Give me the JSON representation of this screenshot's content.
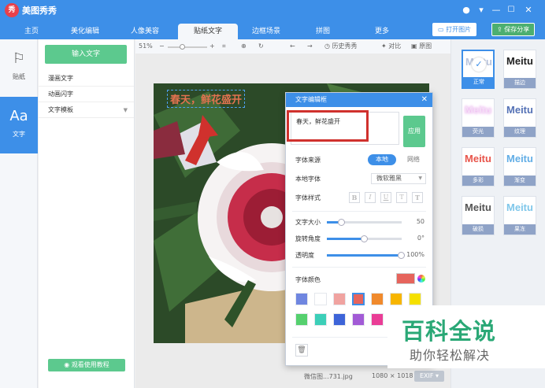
{
  "app": {
    "logo_glyph": "秀",
    "title": "美图秀秀"
  },
  "tabs": [
    {
      "label": "主页"
    },
    {
      "label": "美化编辑"
    },
    {
      "label": "人像美容"
    },
    {
      "label": "贴纸文字",
      "active": true
    },
    {
      "label": "边框场景"
    },
    {
      "label": "拼图"
    },
    {
      "label": "更多"
    }
  ],
  "header_buttons": {
    "open_image": "打开图片",
    "save_share": "保存分享"
  },
  "left_nav": [
    {
      "icon": "bookmark-icon",
      "glyph": "⚐",
      "label": "贴纸"
    },
    {
      "icon": "text-aa-icon",
      "glyph": "Aa",
      "label": "文字",
      "active": true
    }
  ],
  "sub_panel": {
    "primary_button": "输入文字",
    "items": [
      "漫画文字",
      "动画闪字",
      "文字模板"
    ],
    "tutorial_button": "观看使用教程"
  },
  "toolbar": {
    "zoom_label": "51%",
    "history_label": "历史秀秀",
    "compare_label": "对比",
    "original_label": "原图"
  },
  "canvas": {
    "overlay_text": "春天，鲜花盛开",
    "file_name": "微信图...731.jpg",
    "dimensions": "1080 × 1018",
    "exif_label": "EXIF"
  },
  "text_styles": [
    {
      "sample": "Meitu",
      "caption": "正常",
      "active": true
    },
    {
      "sample": "Meitu",
      "caption": "描边"
    },
    {
      "sample": "Meitu",
      "caption": "荧光"
    },
    {
      "sample": "Meitu",
      "caption": "纹理"
    },
    {
      "sample": "Meitu",
      "caption": "多彩"
    },
    {
      "sample": "Meitu",
      "caption": "渐变"
    },
    {
      "sample": "Meitu",
      "caption": "破损"
    },
    {
      "sample": "Meitu",
      "caption": "果冻"
    }
  ],
  "dialog": {
    "title": "文字编辑框",
    "text_value": "春天，鲜花盛开",
    "apply_label": "应用",
    "font_source_label": "字体来源",
    "source_local": "本地",
    "source_web": "网络",
    "local_font_label": "本地字体",
    "font_name": "微软雅黑",
    "font_style_label": "字体样式",
    "style_buttons": [
      "B",
      "I",
      "U",
      "T",
      "T"
    ],
    "size_label": "文字大小",
    "size_value": "50",
    "size_percent": 20,
    "rotation_label": "旋转角度",
    "rotation_value": "0°",
    "rotation_percent": 50,
    "opacity_label": "透明度",
    "opacity_value": "100%",
    "opacity_percent": 100,
    "font_color_label": "字体颜色",
    "current_color": "#e6645c",
    "swatches": [
      "#6f86e0",
      "#ffffff",
      "#f0a3a0",
      "#e6645c",
      "#f08a2c",
      "#f7b500",
      "#f5e000",
      "#55d06e",
      "#3ccfb8",
      "#3d64d8",
      "#a25bd6",
      "#ea3d96"
    ],
    "selected_swatch": 3
  },
  "watermark": {
    "title": "百科全说",
    "subtitle": "助你轻松解决"
  }
}
